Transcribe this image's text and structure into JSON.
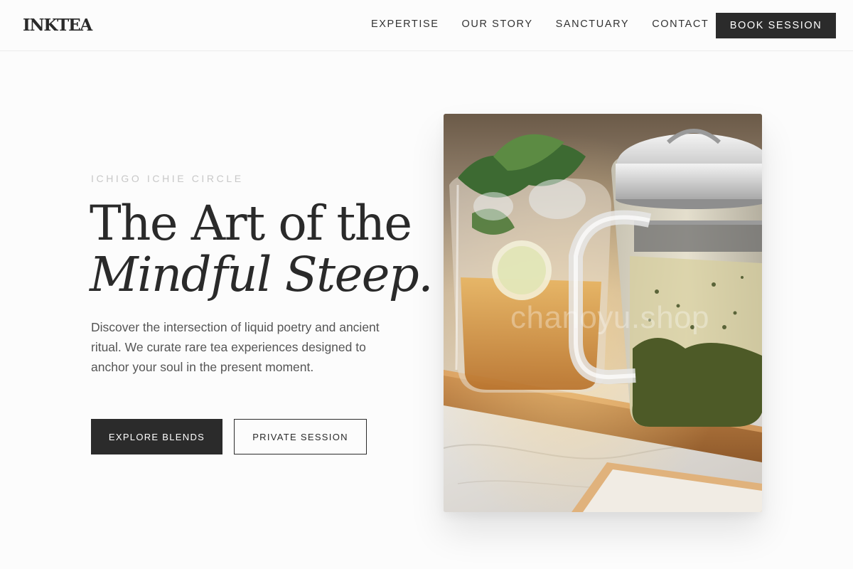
{
  "header": {
    "logo": "INKTEA",
    "nav": [
      "EXPERTISE",
      "OUR STORY",
      "SANCTUARY",
      "CONTACT"
    ],
    "cta": "BOOK SESSION"
  },
  "hero": {
    "eyebrow": "ICHIGO ICHIE CIRCLE",
    "headline_line1": "The Art of the",
    "headline_line2": "Mindful Steep.",
    "description": "Discover the intersection of liquid poetry and ancient ritual. We curate rare tea experiences designed to anchor your soul in the present moment.",
    "primary_button": "EXPLORE BLENDS",
    "secondary_button": "PRIVATE SESSION",
    "image_watermark": "chanoyu.shop"
  },
  "colors": {
    "accent_dark": "#2b2b2b",
    "background": "#fcfcfc",
    "muted_text": "#555555",
    "eyebrow_text": "#c8c8c8"
  }
}
